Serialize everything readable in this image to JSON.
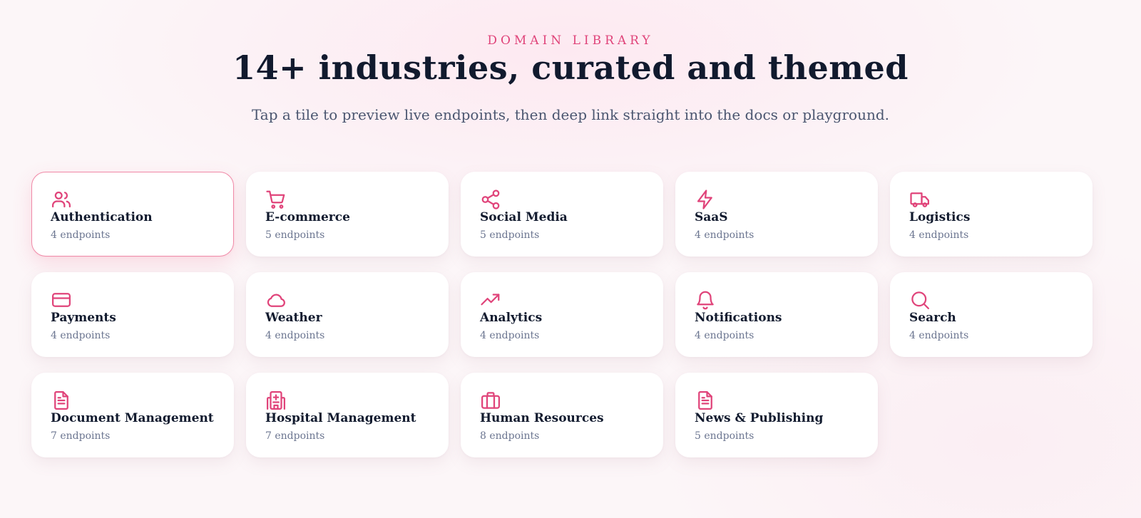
{
  "header": {
    "eyebrow": "DOMAIN LIBRARY",
    "title": "14+ industries, curated and themed",
    "subtitle": "Tap a tile to preview live endpoints, then deep link straight into the docs or playground."
  },
  "accent_color": "#e0447a",
  "tiles": [
    {
      "name": "Authentication",
      "count": "4 endpoints",
      "icon": "users-icon",
      "selected": true
    },
    {
      "name": "E-commerce",
      "count": "5 endpoints",
      "icon": "cart-icon"
    },
    {
      "name": "Social Media",
      "count": "5 endpoints",
      "icon": "share-icon"
    },
    {
      "name": "SaaS",
      "count": "4 endpoints",
      "icon": "lightning-icon"
    },
    {
      "name": "Logistics",
      "count": "4 endpoints",
      "icon": "truck-icon"
    },
    {
      "name": "Payments",
      "count": "4 endpoints",
      "icon": "credit-card-icon"
    },
    {
      "name": "Weather",
      "count": "4 endpoints",
      "icon": "cloud-icon"
    },
    {
      "name": "Analytics",
      "count": "4 endpoints",
      "icon": "trending-up-icon"
    },
    {
      "name": "Notifications",
      "count": "4 endpoints",
      "icon": "bell-icon"
    },
    {
      "name": "Search",
      "count": "4 endpoints",
      "icon": "search-icon"
    },
    {
      "name": "Document Management",
      "count": "7 endpoints",
      "icon": "document-icon"
    },
    {
      "name": "Hospital Management",
      "count": "7 endpoints",
      "icon": "hospital-icon"
    },
    {
      "name": "Human Resources",
      "count": "8 endpoints",
      "icon": "briefcase-icon"
    },
    {
      "name": "News & Publishing",
      "count": "5 endpoints",
      "icon": "newspaper-icon"
    }
  ]
}
